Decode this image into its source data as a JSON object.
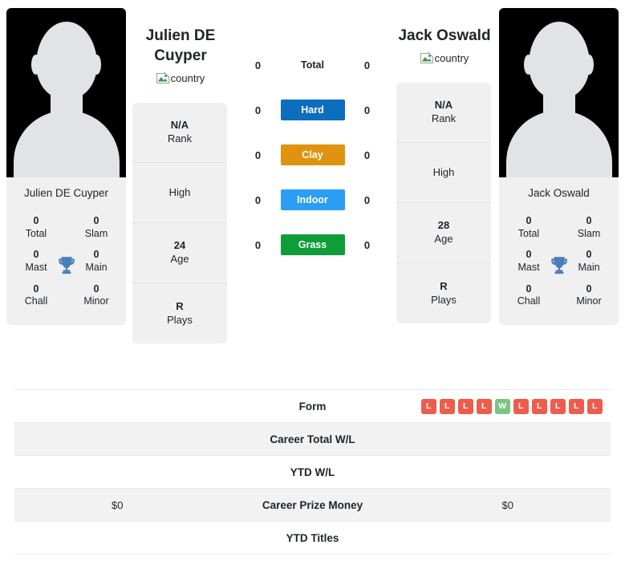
{
  "players": {
    "left": {
      "name": "Julien DE Cuyper",
      "display_name_lines": [
        "Julien DE",
        "Cuyper"
      ],
      "country_alt": "country",
      "titles": {
        "total": {
          "value": "0",
          "label": "Total"
        },
        "slam": {
          "value": "0",
          "label": "Slam"
        },
        "mast": {
          "value": "0",
          "label": "Mast"
        },
        "main": {
          "value": "0",
          "label": "Main"
        },
        "chall": {
          "value": "0",
          "label": "Chall"
        },
        "minor": {
          "value": "0",
          "label": "Minor"
        }
      },
      "info": [
        {
          "value": "N/A",
          "label": "Rank"
        },
        {
          "value": "",
          "label": "High"
        },
        {
          "value": "24",
          "label": "Age"
        },
        {
          "value": "R",
          "label": "Plays"
        }
      ],
      "surface_wins": {
        "total": "0",
        "hard": "0",
        "clay": "0",
        "indoor": "0",
        "grass": "0"
      },
      "career_prize_money": "$0",
      "career_total_wl": "",
      "ytd_wl": "",
      "ytd_titles": ""
    },
    "right": {
      "name": "Jack Oswald",
      "display_name_lines": [
        "Jack Oswald"
      ],
      "country_alt": "country",
      "titles": {
        "total": {
          "value": "0",
          "label": "Total"
        },
        "slam": {
          "value": "0",
          "label": "Slam"
        },
        "mast": {
          "value": "0",
          "label": "Mast"
        },
        "main": {
          "value": "0",
          "label": "Main"
        },
        "chall": {
          "value": "0",
          "label": "Chall"
        },
        "minor": {
          "value": "0",
          "label": "Minor"
        }
      },
      "info": [
        {
          "value": "N/A",
          "label": "Rank"
        },
        {
          "value": "",
          "label": "High"
        },
        {
          "value": "28",
          "label": "Age"
        },
        {
          "value": "R",
          "label": "Plays"
        }
      ],
      "surface_wins": {
        "total": "0",
        "hard": "0",
        "clay": "0",
        "indoor": "0",
        "grass": "0"
      },
      "career_prize_money": "$0",
      "career_total_wl": "",
      "ytd_wl": "",
      "ytd_titles": ""
    }
  },
  "surfaces": [
    {
      "key": "total",
      "label": "Total",
      "color": "transparent",
      "plain": true
    },
    {
      "key": "hard",
      "label": "Hard",
      "color": "#0d6dbf",
      "plain": false
    },
    {
      "key": "clay",
      "label": "Clay",
      "color": "#e0930f",
      "plain": false
    },
    {
      "key": "indoor",
      "label": "Indoor",
      "color": "#2a9df4",
      "plain": false
    },
    {
      "key": "grass",
      "label": "Grass",
      "color": "#0f9d38",
      "plain": false
    }
  ],
  "table": {
    "rows": [
      {
        "label": "Form",
        "left": "",
        "right": "",
        "type": "form"
      },
      {
        "label": "Career Total W/L",
        "left": "",
        "right": "",
        "type": "text"
      },
      {
        "label": "YTD W/L",
        "left": "",
        "right": "",
        "type": "text"
      },
      {
        "label": "Career Prize Money",
        "left": "$0",
        "right": "$0",
        "type": "text"
      },
      {
        "label": "YTD Titles",
        "left": "",
        "right": "",
        "type": "text"
      }
    ]
  },
  "form": {
    "left": [],
    "right": [
      "L",
      "L",
      "L",
      "L",
      "W",
      "L",
      "L",
      "L",
      "L",
      "L"
    ]
  },
  "colors": {
    "hard": "#0d6dbf",
    "clay": "#e0930f",
    "indoor": "#2a9df4",
    "grass": "#0f9d38",
    "loss": "#ee5c4d",
    "win": "#7dc47e",
    "trophy": "#4a7ebb",
    "card_bg": "#f0f0f0",
    "stripe_bg": "#f2f2f2"
  }
}
